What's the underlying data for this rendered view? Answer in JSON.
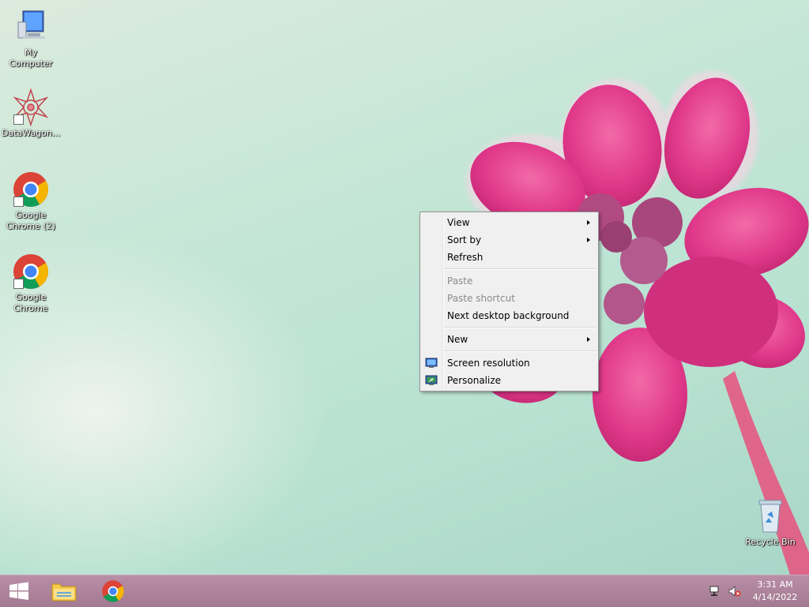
{
  "desktop": {
    "icons": [
      {
        "label": "My Computer"
      },
      {
        "label": "DataWagon..."
      },
      {
        "label": "Google Chrome (2)"
      },
      {
        "label": "Google Chrome"
      },
      {
        "label": "Recycle Bin"
      }
    ]
  },
  "context_menu": {
    "items": [
      {
        "label": "View",
        "submenu": true
      },
      {
        "label": "Sort by",
        "submenu": true
      },
      {
        "label": "Refresh"
      },
      {
        "label": "Paste",
        "disabled": true
      },
      {
        "label": "Paste shortcut",
        "disabled": true
      },
      {
        "label": "Next desktop background"
      },
      {
        "label": "New",
        "submenu": true
      },
      {
        "label": "Screen resolution",
        "icon": "screen-resolution-icon"
      },
      {
        "label": "Personalize",
        "icon": "personalize-icon"
      }
    ]
  },
  "taskbar": {
    "clock": {
      "time": "3:31 AM",
      "date": "4/14/2022"
    },
    "buttons": [
      "start-icon",
      "file-explorer-icon",
      "chrome-icon"
    ],
    "tray": [
      "network-icon",
      "volume-muted-icon"
    ]
  },
  "colors": {
    "taskbar": "#a27a92",
    "flower": "#e2418a",
    "menu_bg": "#f0f0f0"
  }
}
